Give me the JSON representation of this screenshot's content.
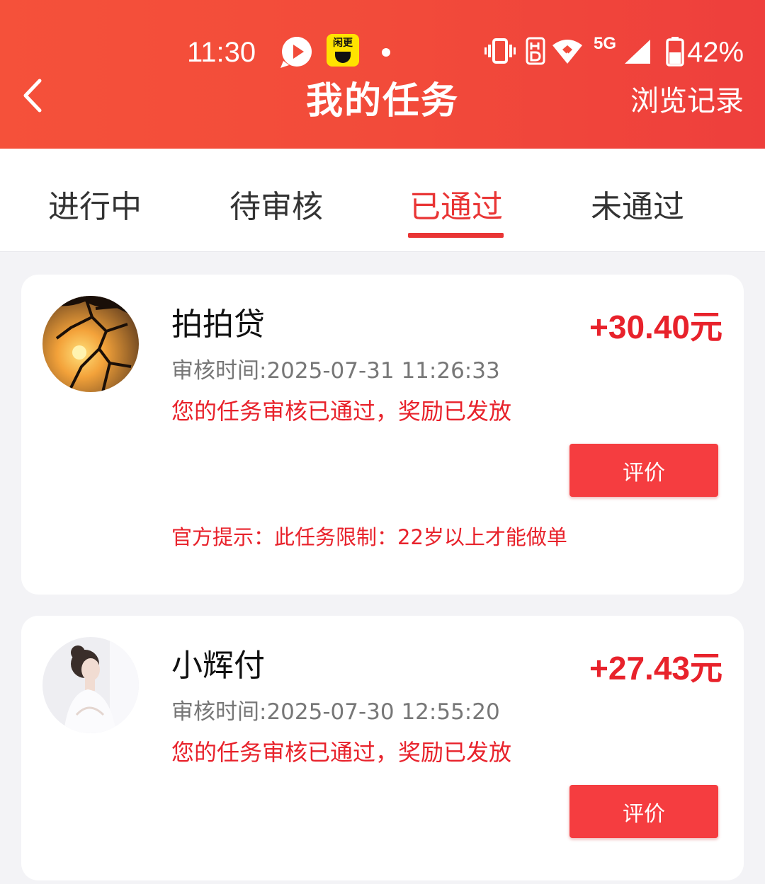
{
  "status_bar": {
    "time": "11:30",
    "app_icon_2_text": "闲更",
    "network": "5G",
    "battery": "42%"
  },
  "header": {
    "title": "我的任务",
    "history_label": "浏览记录",
    "back_icon": "chevron-left-icon",
    "gradient_colors": [
      "#f5513a",
      "#ee3f3c"
    ]
  },
  "tabs": [
    {
      "label": "进行中",
      "active": false
    },
    {
      "label": "待审核",
      "active": false
    },
    {
      "label": "已通过",
      "active": true
    },
    {
      "label": "未通过",
      "active": false
    }
  ],
  "tasks": [
    {
      "title": "拍拍贷",
      "amount": "+30.40元",
      "review_time": "审核时间:2025-07-31 11:26:33",
      "message": "您的任务审核已通过，奖励已发放",
      "button_label": "评价",
      "tip": "官方提示：此任务限制：22岁以上才能做单"
    },
    {
      "title": "小辉付",
      "amount": "+27.43元",
      "review_time": "审核时间:2025-07-30 12:55:20",
      "message": "您的任务审核已通过，奖励已发放",
      "button_label": "评价"
    }
  ],
  "colors": {
    "accent": "#e93535",
    "amount": "#e8222b",
    "button": "#f53d40",
    "background": "#f3f3f6"
  }
}
